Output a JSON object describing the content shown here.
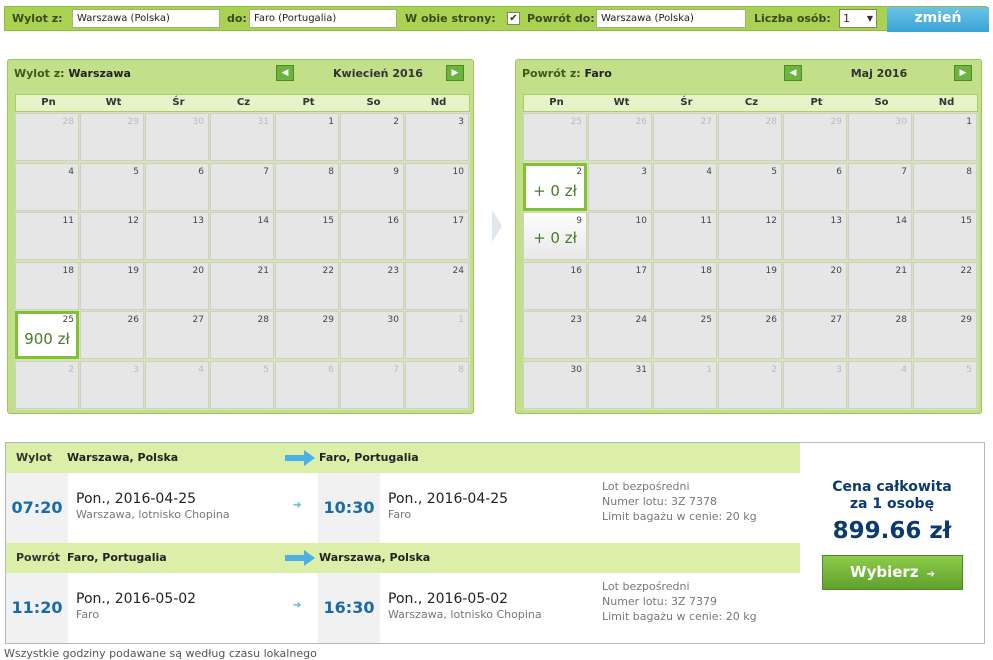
{
  "search": {
    "from_label": "Wylot z:",
    "from_value": "Warszawa (Polska)",
    "to_label": "do:",
    "to_value": "Faro (Portugalia)",
    "roundtrip_label": "W obie strony:",
    "roundtrip_checked": "✔",
    "return_label": "Powrót do:",
    "return_value": "Warszawa (Polska)",
    "persons_label": "Liczba osób:",
    "persons_value": "1",
    "change_button": "zmień"
  },
  "weekdays": [
    "Pn",
    "Wt",
    "Śr",
    "Cz",
    "Pt",
    "So",
    "Nd"
  ],
  "outbound_calendar": {
    "title_prefix": "Wylot z:",
    "title_city": "Warszawa",
    "month": "Kwiecień 2016",
    "prev": "◀",
    "next": "▶",
    "days": [
      {
        "d": "28",
        "m": true
      },
      {
        "d": "29",
        "m": true
      },
      {
        "d": "30",
        "m": true
      },
      {
        "d": "31",
        "m": true
      },
      {
        "d": "1"
      },
      {
        "d": "2"
      },
      {
        "d": "3"
      },
      {
        "d": "4"
      },
      {
        "d": "5"
      },
      {
        "d": "6"
      },
      {
        "d": "7"
      },
      {
        "d": "8"
      },
      {
        "d": "9"
      },
      {
        "d": "10"
      },
      {
        "d": "11"
      },
      {
        "d": "12"
      },
      {
        "d": "13"
      },
      {
        "d": "14"
      },
      {
        "d": "15"
      },
      {
        "d": "16"
      },
      {
        "d": "17"
      },
      {
        "d": "18"
      },
      {
        "d": "19"
      },
      {
        "d": "20"
      },
      {
        "d": "21"
      },
      {
        "d": "22"
      },
      {
        "d": "23"
      },
      {
        "d": "24"
      },
      {
        "d": "25",
        "price": "900 zł",
        "selected": true
      },
      {
        "d": "26"
      },
      {
        "d": "27"
      },
      {
        "d": "28"
      },
      {
        "d": "29"
      },
      {
        "d": "30"
      },
      {
        "d": "1",
        "m": true
      },
      {
        "d": "2",
        "m": true
      },
      {
        "d": "3",
        "m": true
      },
      {
        "d": "4",
        "m": true
      },
      {
        "d": "5",
        "m": true
      },
      {
        "d": "6",
        "m": true
      },
      {
        "d": "7",
        "m": true
      },
      {
        "d": "8",
        "m": true
      }
    ]
  },
  "return_calendar": {
    "title_prefix": "Powrót z:",
    "title_city": "Faro",
    "month": "Maj 2016",
    "prev": "◀",
    "next": "▶",
    "days": [
      {
        "d": "25",
        "m": true
      },
      {
        "d": "26",
        "m": true
      },
      {
        "d": "27",
        "m": true
      },
      {
        "d": "28",
        "m": true
      },
      {
        "d": "29",
        "m": true
      },
      {
        "d": "30",
        "m": true
      },
      {
        "d": "1"
      },
      {
        "d": "2",
        "price": "+ 0 zł",
        "selected": true
      },
      {
        "d": "3"
      },
      {
        "d": "4"
      },
      {
        "d": "5"
      },
      {
        "d": "6"
      },
      {
        "d": "7"
      },
      {
        "d": "8"
      },
      {
        "d": "9",
        "price": "+ 0 zł",
        "avail": true
      },
      {
        "d": "10"
      },
      {
        "d": "11"
      },
      {
        "d": "12"
      },
      {
        "d": "13"
      },
      {
        "d": "14"
      },
      {
        "d": "15"
      },
      {
        "d": "16"
      },
      {
        "d": "17"
      },
      {
        "d": "18"
      },
      {
        "d": "19"
      },
      {
        "d": "20"
      },
      {
        "d": "21"
      },
      {
        "d": "22"
      },
      {
        "d": "23"
      },
      {
        "d": "24"
      },
      {
        "d": "25"
      },
      {
        "d": "26"
      },
      {
        "d": "27"
      },
      {
        "d": "28"
      },
      {
        "d": "29"
      },
      {
        "d": "30"
      },
      {
        "d": "31"
      },
      {
        "d": "1",
        "m": true
      },
      {
        "d": "2",
        "m": true
      },
      {
        "d": "3",
        "m": true
      },
      {
        "d": "4",
        "m": true
      },
      {
        "d": "5",
        "m": true
      }
    ]
  },
  "outbound": {
    "label": "Wylot",
    "from": "Warszawa, Polska",
    "to": "Faro, Portugalia",
    "dep_time": "07:20",
    "dep_date": "Pon., 2016-04-25",
    "dep_place": "Warszawa, lotnisko Chopina",
    "arr_time": "10:30",
    "arr_date": "Pon., 2016-04-25",
    "arr_place": "Faro",
    "arrow": "➔",
    "meta1": "Lot bezpośredni",
    "meta2": "Numer lotu: 3Z 7378",
    "meta3": "Limit bagażu w cenie: 20 kg"
  },
  "inbound": {
    "label": "Powrót",
    "from": "Faro, Portugalia",
    "to": "Warszawa, Polska",
    "dep_time": "11:20",
    "dep_date": "Pon., 2016-05-02",
    "dep_place": "Faro",
    "arr_time": "16:30",
    "arr_date": "Pon., 2016-05-02",
    "arr_place": "Warszawa, lotnisko Chopina",
    "arrow": "➔",
    "meta1": "Lot bezpośredni",
    "meta2": "Numer lotu: 3Z 7379",
    "meta3": "Limit bagażu w cenie: 20 kg"
  },
  "summary": {
    "line1": "Cena całkowita",
    "line2": "za 1 osobę",
    "price": "899.66 zł",
    "button": "Wybierz",
    "button_arrow": "➔"
  },
  "footer_note": "Wszystkie godziny podawane są według czasu lokalnego",
  "colors": {
    "accent_green": "#a9d252",
    "button_blue": "#3aa3d4",
    "price_navy": "#0b3b6e",
    "time_blue": "#1a6aa8"
  }
}
